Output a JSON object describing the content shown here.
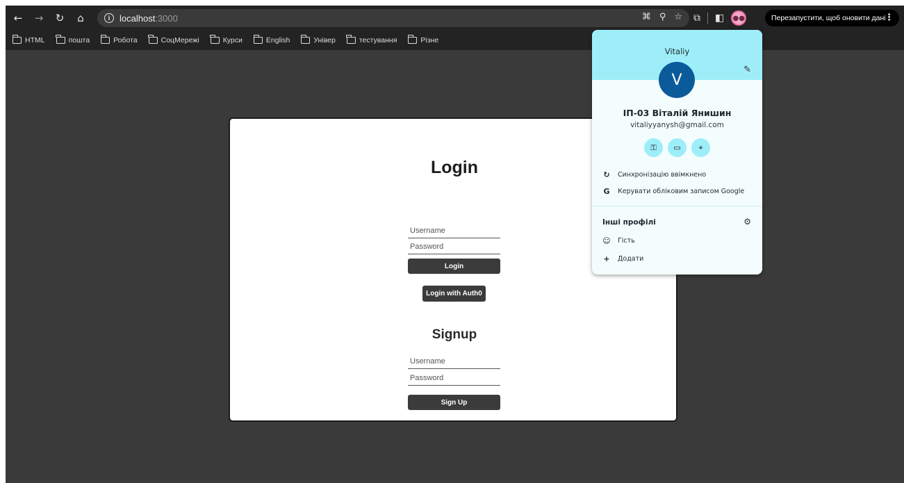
{
  "toolbar": {
    "back_icon": "←",
    "forward_icon": "→",
    "reload_icon": "↻",
    "home_icon": "⌂",
    "url_host": "localhost",
    "url_port": ":3000",
    "update_text": "Перезапустити, щоб оновити дані"
  },
  "bookmarks": [
    "HTML",
    "пошта",
    "Робота",
    "СоцМережі",
    "Курси",
    "English",
    "Універ",
    "тестування",
    "Різне"
  ],
  "login": {
    "title": "Login",
    "username_placeholder": "Username",
    "password_placeholder": "Password",
    "login_button": "Login",
    "auth0_button": "Login with Auth0"
  },
  "signup": {
    "title": "Signup",
    "username_placeholder": "Username",
    "password_placeholder": "Password",
    "signup_button": "Sign Up"
  },
  "profile": {
    "name": "Vitaliy",
    "initial": "V",
    "full_name": "ІП-03 Віталій Янишин",
    "email": "vitaliyyanysh@gmail.com",
    "sync_label": "Синхронізацію ввімкнено",
    "manage_label": "Керувати обліковим записом Google",
    "other_profiles_label": "Інші профілі",
    "guest_label": "Гість",
    "add_label": "Додати"
  },
  "colors": {
    "accent": "#9deef8",
    "avatar": "#0b5a9a",
    "page_bg": "#3a3a3a"
  }
}
